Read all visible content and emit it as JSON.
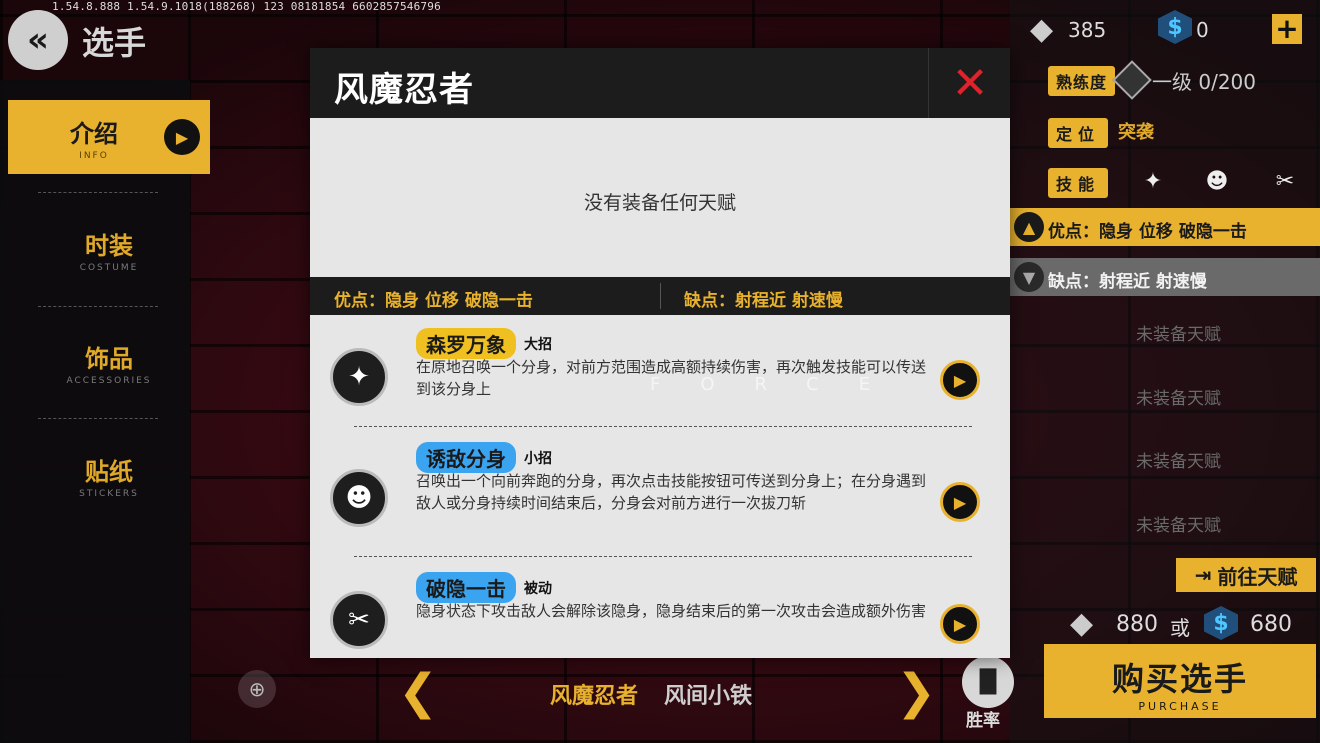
{
  "debug_line": "1.54.8.888  1.54.9.1018(188268)  123  08181854  6602857546796",
  "header": {
    "back_icon": "double-chevron-left-icon",
    "title": "选手"
  },
  "nav": [
    {
      "zh": "介绍",
      "en": "INFO",
      "active": true
    },
    {
      "zh": "时装",
      "en": "COSTUME",
      "active": false
    },
    {
      "zh": "饰品",
      "en": "ACCESSORIES",
      "active": false
    },
    {
      "zh": "贴纸",
      "en": "STICKERS",
      "active": false
    }
  ],
  "currency": {
    "diamond": "385",
    "coin": "0",
    "coin_symbol": "$",
    "plus": "+"
  },
  "info": {
    "proficiency_label": "熟练度",
    "proficiency_value": "一级 0/200",
    "role_label": "定位",
    "role_value": "突袭",
    "skill_label": "技能",
    "pros_bar": "优点：隐身  位移  破隐一击",
    "cons_bar": "缺点：射程近  射速慢",
    "talent_slots": [
      "未装备天赋",
      "未装备天赋",
      "未装备天赋",
      "未装备天赋"
    ],
    "goto_talent": "前往天赋"
  },
  "purchase": {
    "diamond_price": "880",
    "or": "或",
    "coin_price": "680",
    "coin_symbol": "$",
    "label_zh": "购买选手",
    "label_en": "PURCHASE"
  },
  "bottom": {
    "name_current": "风魔忍者",
    "name_next": "风间小铁",
    "winrate_label": "胜率"
  },
  "modal": {
    "title": "风魔忍者",
    "close": "✕",
    "no_talent": "没有装备任何天赋",
    "pros": "优点：隐身  位移  破隐一击",
    "cons": "缺点：射程近  射速慢",
    "watermark": "FORCE",
    "skills": [
      {
        "name": "森罗万象",
        "type": "大招",
        "desc": "在原地召唤一个分身，对前方范围造成高额持续伤害，再次触发技能可以传送到该分身上",
        "color": "#f0c020",
        "icon": "shuriken-icon"
      },
      {
        "name": "诱敌分身",
        "type": "小招",
        "desc": "召唤出一个向前奔跑的分身，再次点击技能按钮可传送到分身上；在分身遇到敌人或分身持续时间结束后，分身会对前方进行一次拔刀斩",
        "color": "#3aa4f0",
        "icon": "twin-figure-icon"
      },
      {
        "name": "破隐一击",
        "type": "被动",
        "desc": "隐身状态下攻击敌人会解除该隐身，隐身结束后的第一次攻击会造成额外伤害",
        "color": "#3aa4f0",
        "icon": "blades-icon"
      }
    ]
  },
  "colors": {
    "accent": "#e8b22e",
    "close_red": "#e0222a",
    "blue_tag": "#3aa4f0",
    "yellow_tag": "#f0c020"
  }
}
